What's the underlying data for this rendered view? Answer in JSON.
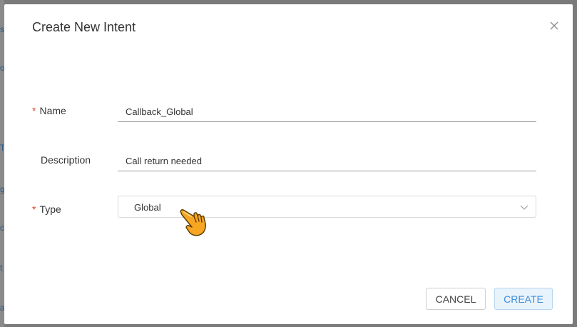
{
  "modal": {
    "title": "Create New Intent",
    "close_icon": "close-icon"
  },
  "form": {
    "name": {
      "label": "Name",
      "required_marker": "*",
      "value": "Callback_Global"
    },
    "description": {
      "label": "Description",
      "value": "Call return needed"
    },
    "type": {
      "label": "Type",
      "required_marker": "*",
      "selected": "Global",
      "icon": "chevron-down-icon"
    }
  },
  "buttons": {
    "cancel_label": "CANCEL",
    "create_label": "CREATE"
  },
  "colors": {
    "required": "#e0452b",
    "primary": "#3f8fd8",
    "primary_bg": "#e9f3fc",
    "cursor_fill": "#f6a623"
  }
}
